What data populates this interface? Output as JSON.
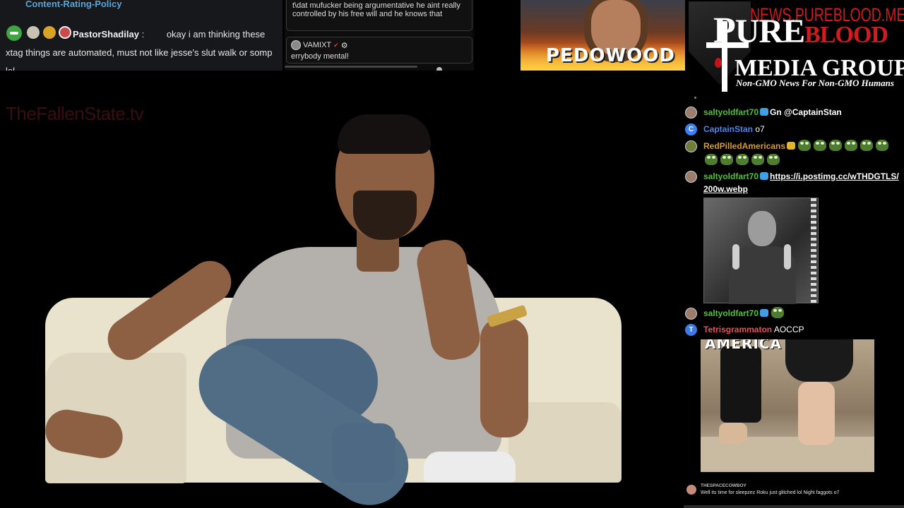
{
  "left_chat": {
    "top_link": "Content-Rating-Policy",
    "message": {
      "user": "PastorShadilay",
      "separator": ":",
      "text": "okay i am thinking these xtag things are automated, must not like jesse's slut walk or somp lol"
    }
  },
  "center_chat": {
    "message1": "t\\dat mufucker being argumentative he aint really controlled by his free will and he knows that",
    "message2": {
      "user": "VAMIXT",
      "text": "errybody mental!"
    }
  },
  "thumbnail": {
    "text": "PEDOWOOD"
  },
  "brand": {
    "url": "NEWS.PUREBLOOD.MEDIA",
    "line1_first": "P",
    "line1_rest": "URE",
    "line1_red": "BLOOD",
    "line2": "MEDIA GROUP",
    "tagline": "Non-GMO News For Non-GMO Humans"
  },
  "video": {
    "watermark": "TheFallenState.tv"
  },
  "right_chat": {
    "messages": [
      {
        "user": "saltyoldfart70",
        "mention": "Gn @CaptainStan"
      },
      {
        "user": "CaptainStan",
        "avatar_letter": "C",
        "text": "o7"
      },
      {
        "user": "RedPilledAmericans"
      },
      {
        "user": "saltyoldfart70",
        "link": "https://i.postimg.cc/wTHDGTLS/200w.webp"
      },
      {
        "user": "saltyoldfart70"
      },
      {
        "user": "Tetrisgrammaton",
        "avatar_letter": "T",
        "text": "AOCCP"
      }
    ],
    "image_caption": "AMERICA",
    "small_message": {
      "user": "THESPACECOWBOY",
      "text": "Well its time for sleepzez Roku just glitched lol Night faggots o7"
    }
  },
  "colors": {
    "green_user": "#52c13a",
    "blue_user": "#4a86f0",
    "gold_user": "#d99c2a",
    "red_user": "#e8505a",
    "brand_red": "#d21a1f",
    "policy_link": "#57a6d8"
  }
}
